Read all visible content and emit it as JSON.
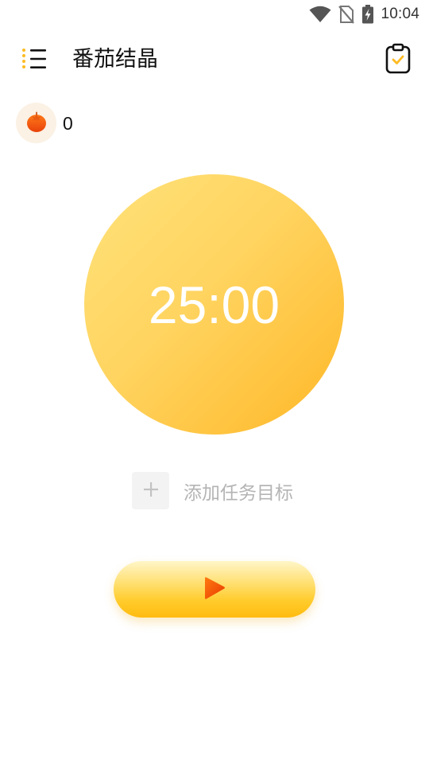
{
  "status_bar": {
    "time": "10:04",
    "icons": [
      "wifi-icon",
      "no-sim-icon",
      "battery-charging-icon"
    ]
  },
  "app_bar": {
    "title": "番茄结晶",
    "menu_icon": "menu-icon",
    "action_icon": "clipboard-check-icon"
  },
  "tomato": {
    "icon": "tomato-icon",
    "count": "0"
  },
  "timer": {
    "time": "25:00"
  },
  "add_task": {
    "icon": "plus-icon",
    "label": "添加任务目标"
  },
  "start_button": {
    "icon": "play-icon"
  },
  "colors": {
    "accent": "#ffc83a",
    "accent_dark": "#ffb727",
    "play_orange": "#f2540a",
    "placeholder_gray": "#b4b4b4"
  }
}
